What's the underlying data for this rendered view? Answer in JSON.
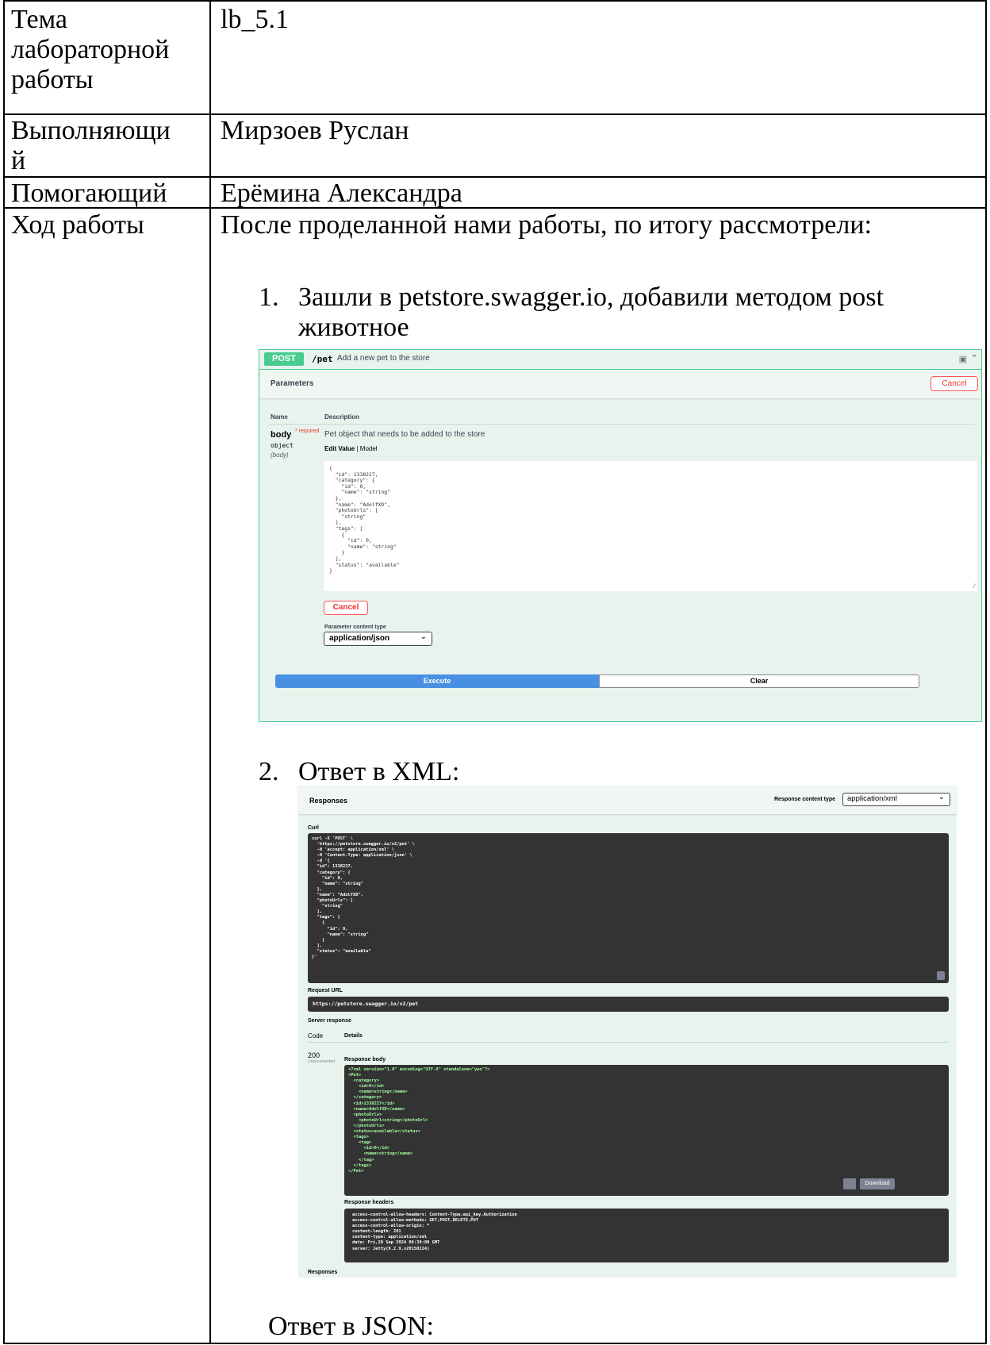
{
  "rows": [
    {
      "label": "Тема лабораторной работы",
      "value": "lb_5.1"
    },
    {
      "label": "Выполняющий",
      "value": "Мирзоев Руслан"
    },
    {
      "label": "Помогающий",
      "value": "Ерёмина Александра"
    },
    {
      "label": "Ход работы",
      "value": "После проделанной нами работы, по итогу рассмотрели:"
    }
  ],
  "label_lines": {
    "r1a": "Тема",
    "r1b": "лабораторной",
    "r1c": "работы",
    "r2a": "Выполняющи",
    "r2b": "й"
  },
  "steps": [
    {
      "num": "1.",
      "line1": "Зашли в petstore.swagger.io, добавили методом post",
      "line2": "животное"
    },
    {
      "num": "2.",
      "line1": "Ответ в XML:"
    }
  ],
  "footer_text": "Ответ в JSON:",
  "shot1": {
    "method": "POST",
    "path": "/pet",
    "summary": "Add a new pet to the store",
    "parameters_label": "Parameters",
    "cancel_label": "Cancel",
    "col_name": "Name",
    "col_description": "Description",
    "param_name": "body",
    "required_label": "* required",
    "param_type": "object",
    "param_in": "(body)",
    "param_desc": "Pet object that needs to be added to the store",
    "edit_value": "Edit Value",
    "model": "Model",
    "body_json": "{\n  \"id\": 1338227,\n  \"category\": {\n    \"id\": 0,\n    \"name\": \"string\"\n  },\n  \"name\": \"AdolfXD\",\n  \"photoUrls\": [\n    \"string\"\n  ],\n  \"tags\": [\n    {\n      \"id\": 0,\n      \"name\": \"string\"\n    }\n  ],\n  \"status\": \"available\"\n}",
    "content_type_label": "Parameter content type",
    "content_type_value": "application/json",
    "execute_label": "Execute",
    "clear_label": "Clear",
    "colors": {
      "post": "#49cc90",
      "execute": "#4990e2"
    }
  },
  "shot2": {
    "responses_label": "Responses",
    "response_content_type_label": "Response content type",
    "response_content_type_value": "application/xml",
    "curl_label": "Curl",
    "curl_text": "curl -X 'POST' \\\n  'https://petstore.swagger.io/v2/pet' \\\n  -H 'accept: application/xml' \\\n  -H 'Content-Type: application/json' \\\n  -d '{\n  \"id\": 1338227,\n  \"category\": {\n    \"id\": 0,\n    \"name\": \"string\"\n  },\n  \"name\": \"AdolfXD\",\n  \"photoUrls\": [\n    \"string\"\n  ],\n  \"tags\": [\n    {\n      \"id\": 0,\n      \"name\": \"string\"\n    }\n  ],\n  \"status\": \"available\"\n}'",
    "request_url_label": "Request URL",
    "request_url": "https://petstore.swagger.io/v2/pet",
    "server_response_label": "Server response",
    "code_label": "Code",
    "details_label": "Details",
    "code": "200",
    "undocumented": "Undocumented",
    "response_body_label": "Response body",
    "response_xml": "<?xml version=\"1.0\" encoding=\"UTF-8\" standalone=\"yes\"?>\n<Pet>\n  <category>\n    <id>0</id>\n    <name>string</name>\n  </category>\n  <id>1338227</id>\n  <name>AdolfXD</name>\n  <photoUrls>\n    <photoUrl>string</photoUrl>\n  </photoUrls>\n  <status>available</status>\n  <tags>\n    <tag>\n      <id>0</id>\n      <name>string</name>\n    </tag>\n  </tags>\n</Pet>",
    "download_label": "Download",
    "response_headers_label": "Response headers",
    "response_headers": "access-control-allow-headers: Content-Type,api_key,Authorization\naccess-control-allow-methods: GET,POST,DELETE,PUT\naccess-control-allow-origin: *\ncontent-length: 281\ncontent-type: application/xml\ndate: Fri,20 Sep 2024 06:39:00 GMT\nserver: Jetty(9.2.9.v20150224)",
    "footer_responses_label": "Responses"
  }
}
